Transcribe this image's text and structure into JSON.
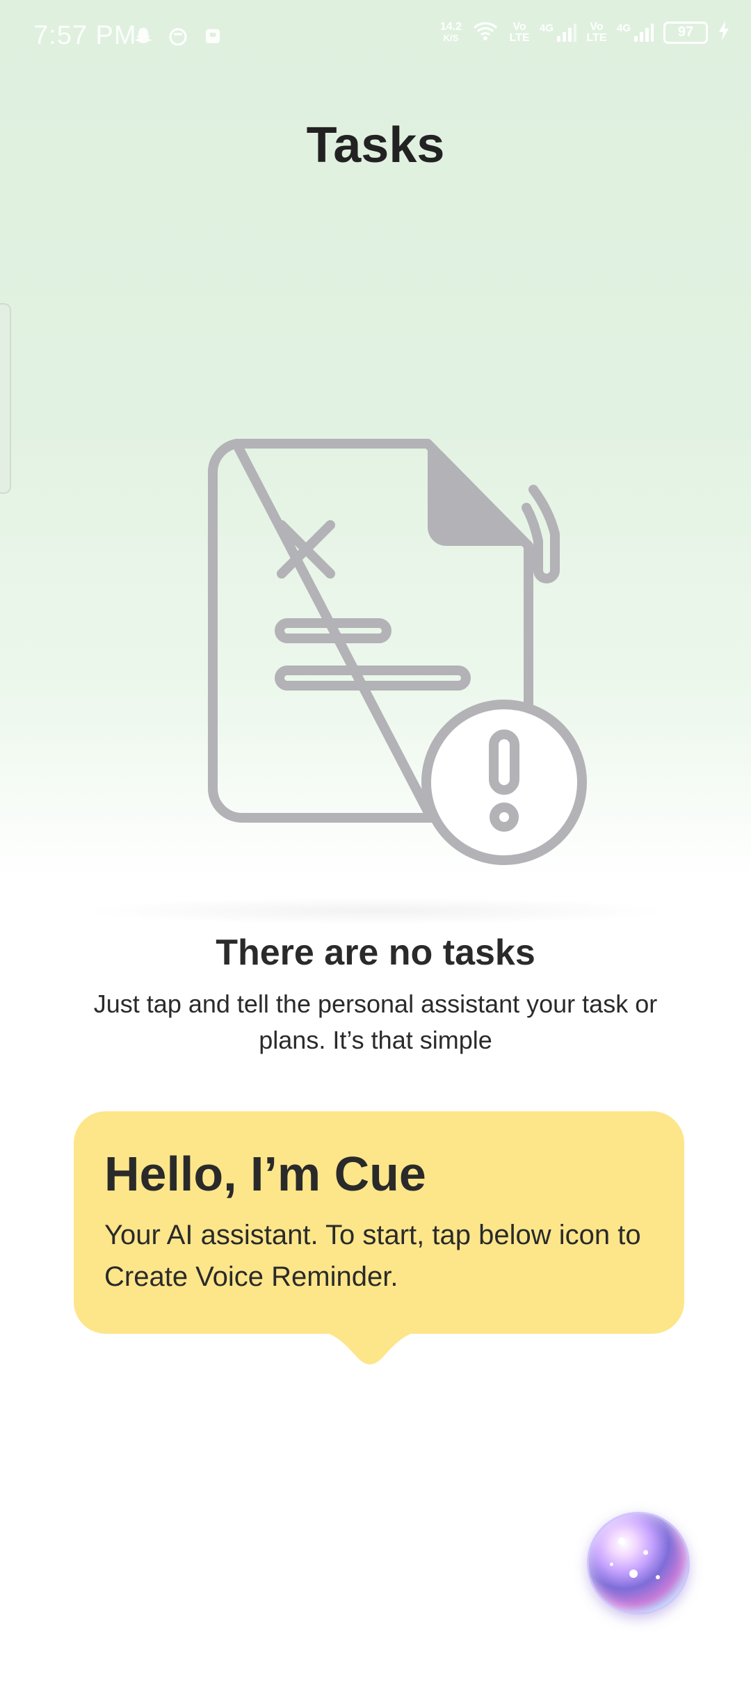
{
  "status_bar": {
    "time": "7:57 PM",
    "net_speed_value": "14.2",
    "net_speed_unit": "K/S",
    "volte_1": "Vo LTE",
    "net_1": "4G",
    "volte_2": "Vo LTE",
    "net_2": "4G",
    "battery": "97"
  },
  "header": {
    "title": "Tasks"
  },
  "empty_state": {
    "title": "There are no tasks",
    "subtitle": "Just tap and tell the personal assistant your task or plans. It’s that simple"
  },
  "assistant_bubble": {
    "title": "Hello, I’m Cue",
    "line1": "Your AI assistant. To start, tap below icon to",
    "line2": "Create Voice Reminder."
  },
  "colors": {
    "bubble": "#fde68a",
    "illustration_stroke": "#b3b2b6",
    "background_top": "#dff0df"
  },
  "icons": {
    "snapchat": "snapchat-icon",
    "notification_app": "app-icon",
    "wifi": "wifi-icon",
    "signal": "signal-icon",
    "battery": "battery-icon",
    "charging": "charging-icon",
    "illustration": "document-error-icon",
    "voice_button": "voice-orb-icon"
  }
}
